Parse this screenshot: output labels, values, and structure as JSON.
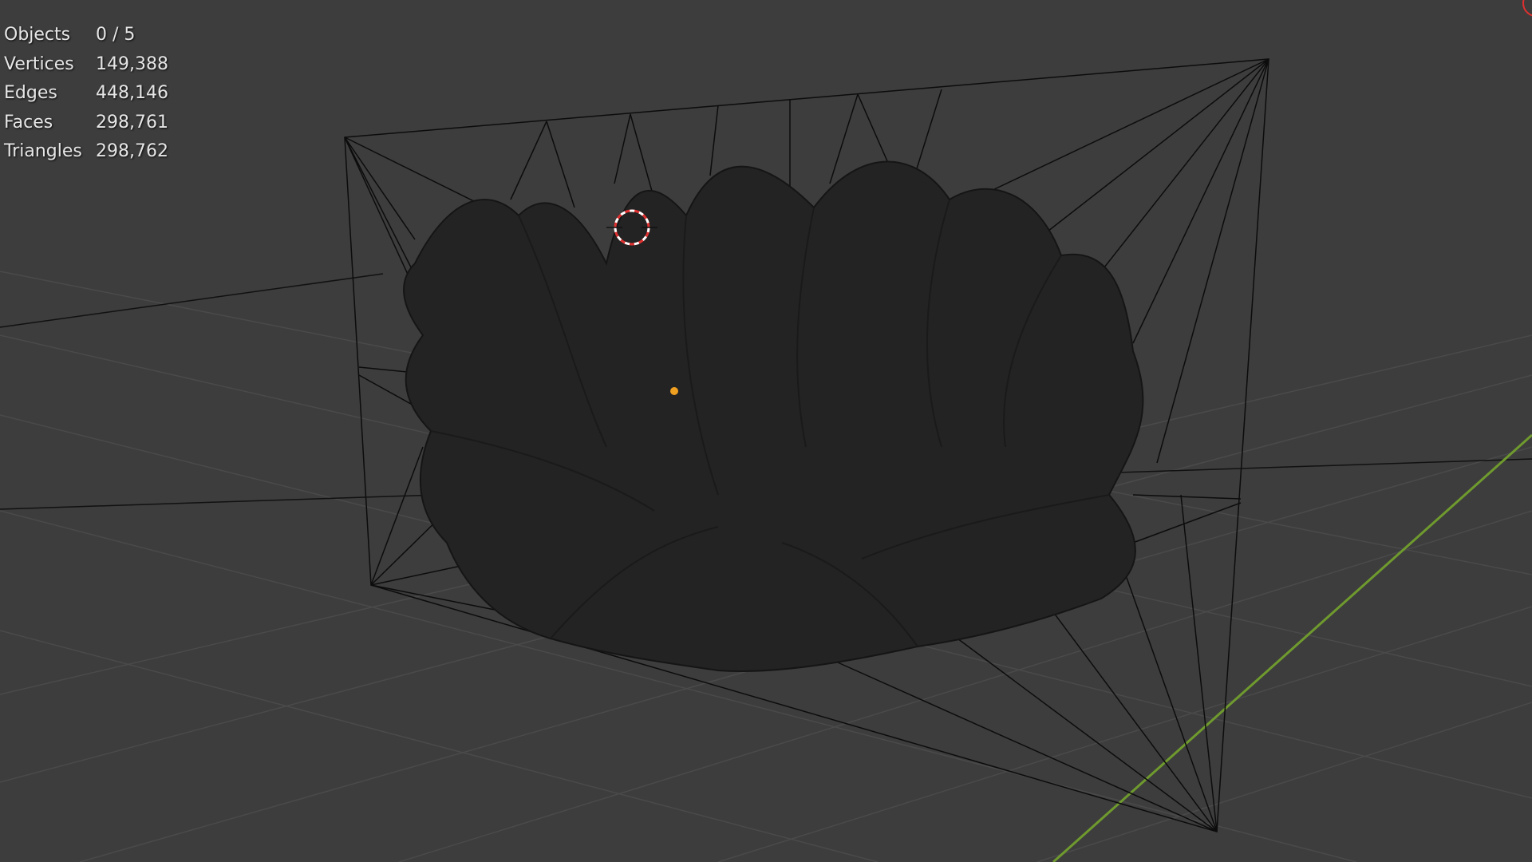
{
  "stats": {
    "objects": {
      "label": "Objects",
      "value": "0 / 5"
    },
    "vertices": {
      "label": "Vertices",
      "value": "149,388"
    },
    "edges": {
      "label": "Edges",
      "value": "448,146"
    },
    "faces": {
      "label": "Faces",
      "value": "298,761"
    },
    "triangles": {
      "label": "Triangles",
      "value": "298,762"
    }
  },
  "colors": {
    "viewport_bg": "#3d3d3d",
    "grid_line": "#4a4a4a",
    "y_axis": "#6f9a2e",
    "mesh_fill": "#232323",
    "wireframe": "#0c0c0c",
    "origin_dot": "#f0a020",
    "cursor_red": "#e03030",
    "cursor_white": "#ffffff"
  }
}
